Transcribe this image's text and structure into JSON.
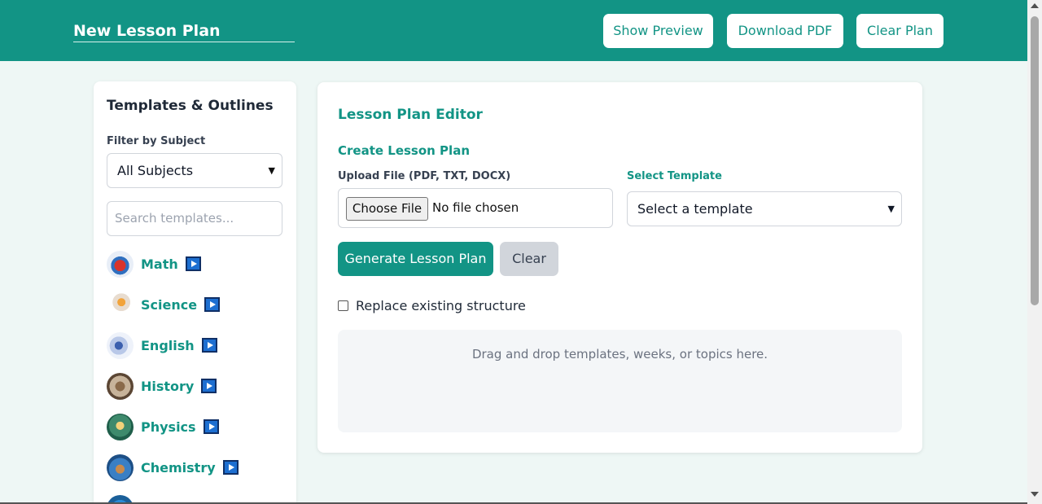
{
  "header": {
    "title": "New Lesson Plan",
    "buttons": {
      "preview": "Show Preview",
      "download": "Download PDF",
      "clear_plan": "Clear Plan"
    }
  },
  "sidebar": {
    "title": "Templates & Outlines",
    "filter_label": "Filter by Subject",
    "filter_value": "All Subjects",
    "search_placeholder": "Search templates...",
    "subjects": [
      {
        "label": "Math",
        "icon": "math-avatar"
      },
      {
        "label": "Science",
        "icon": "science-avatar"
      },
      {
        "label": "English",
        "icon": "english-avatar"
      },
      {
        "label": "History",
        "icon": "history-avatar"
      },
      {
        "label": "Physics",
        "icon": "physics-avatar"
      },
      {
        "label": "Chemistry",
        "icon": "chemistry-avatar"
      }
    ]
  },
  "editor": {
    "title": "Lesson Plan Editor",
    "create_title": "Create Lesson Plan",
    "upload_label": "Upload File (PDF, TXT, DOCX)",
    "choose_file_label": "Choose File",
    "file_status": "No file chosen",
    "template_label": "Select Template",
    "template_value": "Select a template",
    "generate_label": "Generate Lesson Plan",
    "clear_label": "Clear",
    "replace_label": "Replace existing structure",
    "replace_checked": false,
    "dropzone_text": "Drag and drop templates, weeks, or topics here."
  },
  "colors": {
    "accent": "#129485",
    "play_icon": "#1d6fd1",
    "background": "#eef7f5"
  }
}
